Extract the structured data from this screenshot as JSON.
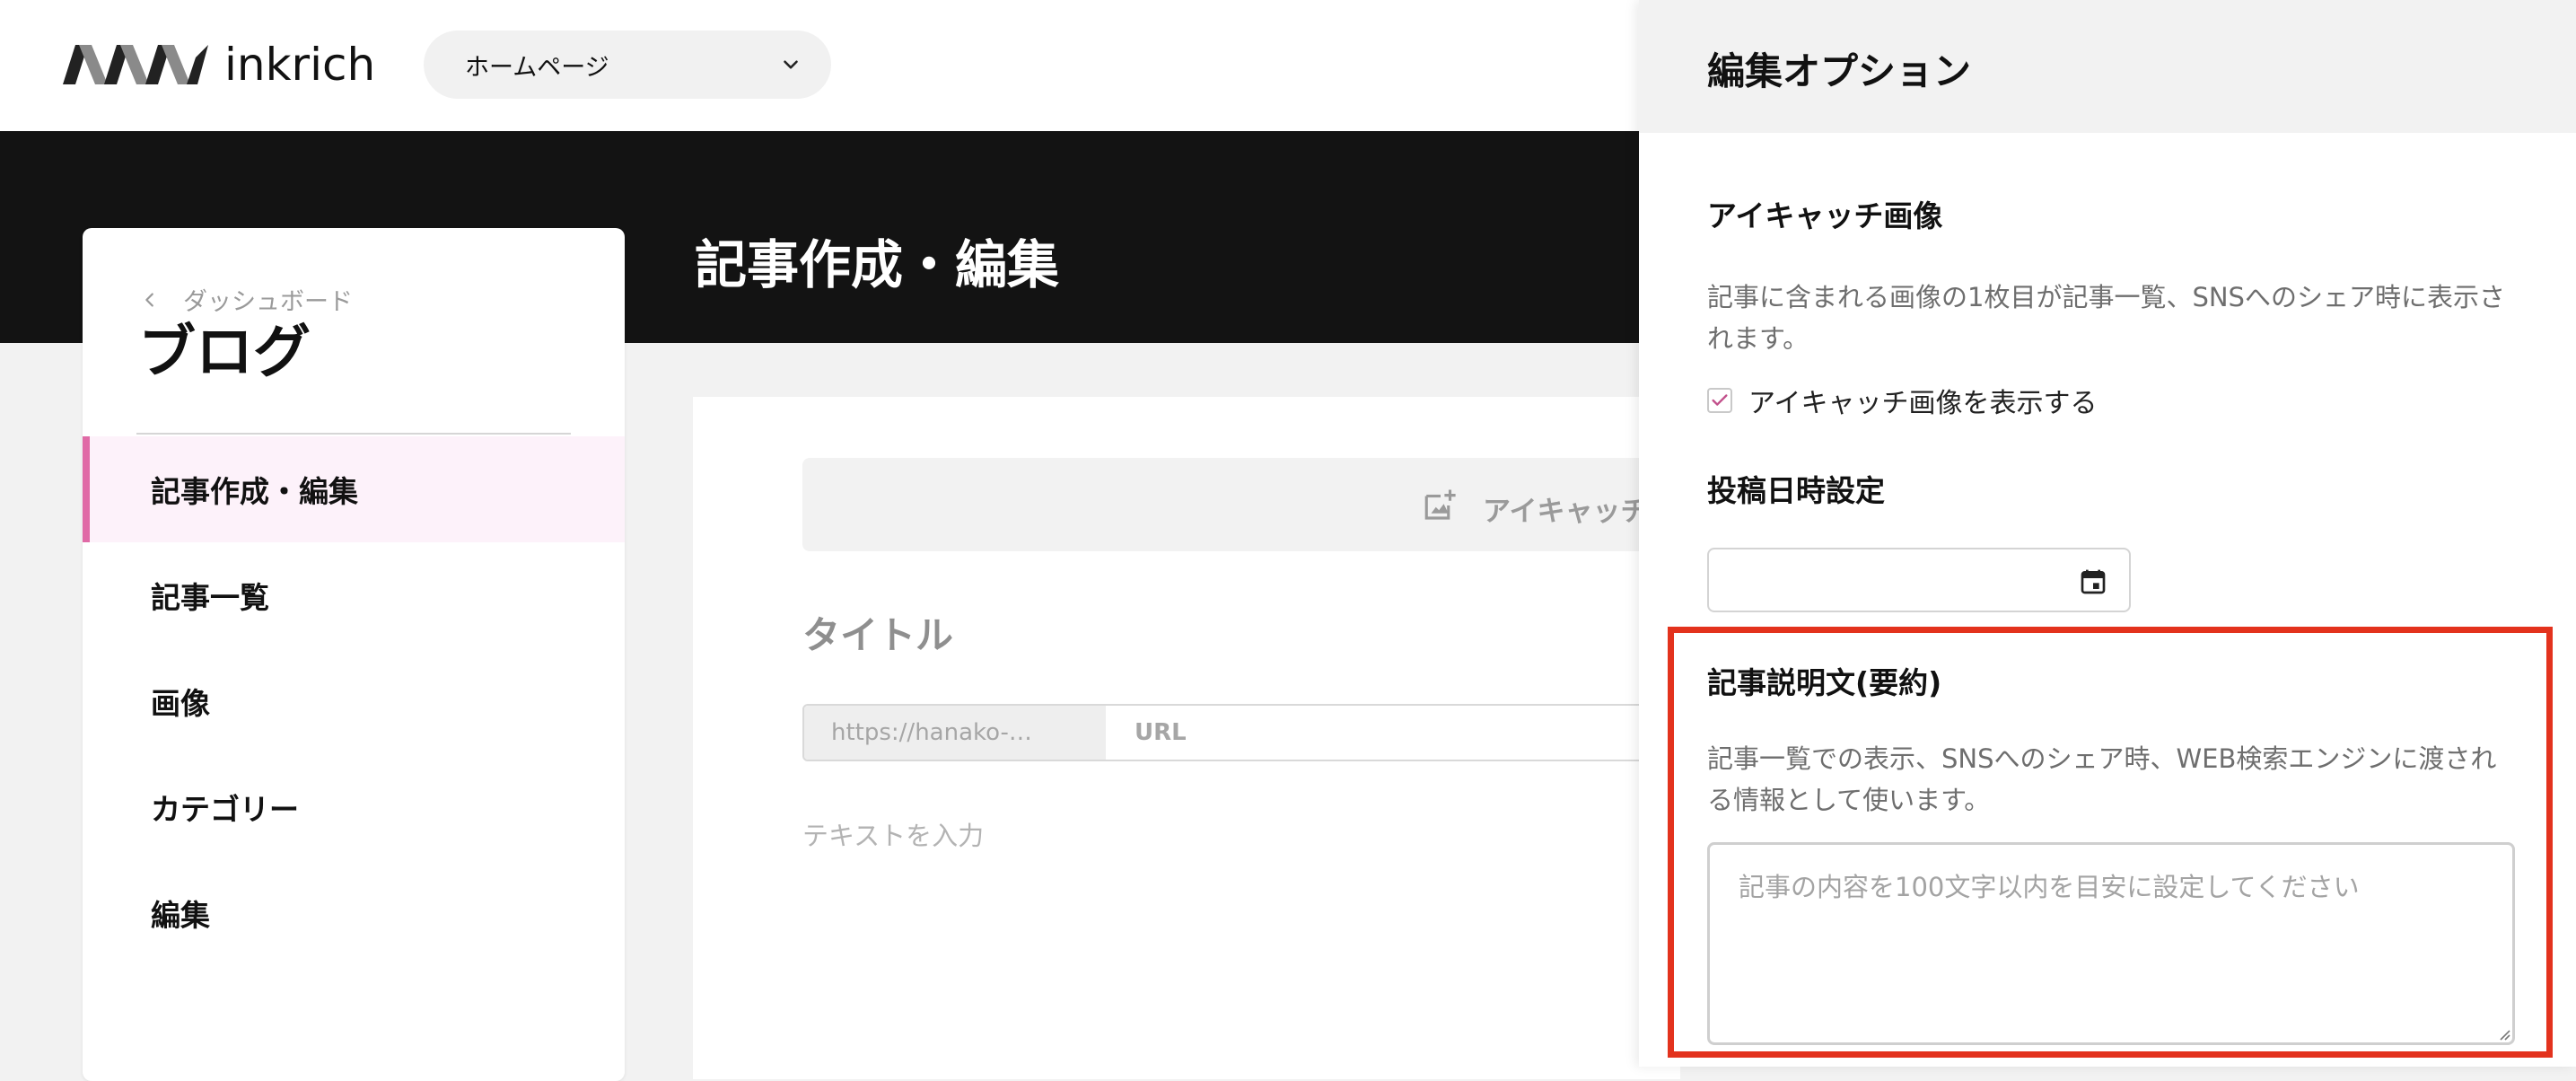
{
  "brand": {
    "name": "inkrich"
  },
  "page_select": {
    "value": "ホームページ"
  },
  "hero": {
    "title": "記事作成・編集"
  },
  "sidebar": {
    "breadcrumb": "ダッシュボード",
    "title": "ブログ",
    "items": [
      {
        "label": "記事作成・編集",
        "active": true
      },
      {
        "label": "記事一覧"
      },
      {
        "label": "画像"
      },
      {
        "label": "カテゴリー"
      },
      {
        "label": "編集"
      }
    ]
  },
  "editor": {
    "eyecatch_label": "アイキャッチ",
    "title_placeholder": "タイトル",
    "url_prefix": "https://hanako-…",
    "url_placeholder": "URL",
    "body_placeholder": "テキストを入力"
  },
  "options_panel": {
    "title": "編集オプション",
    "eyecatch": {
      "heading": "アイキャッチ画像",
      "description": "記事に含まれる画像の1枚目が記事一覧、SNSへのシェア時に表示されます。",
      "checkbox_label": "アイキャッチ画像を表示する",
      "checked": true
    },
    "post_date": {
      "heading": "投稿日時設定",
      "value": ""
    },
    "summary": {
      "heading": "記事説明文(要約)",
      "description": "記事一覧での表示、SNSへのシェア時、WEB検索エンジンに渡される情報として使います。",
      "placeholder": "記事の内容を100文字以内を目安に設定してください",
      "value": ""
    }
  },
  "icons": {
    "page_select": "chevron-down-icon",
    "breadcrumb": "chevron-left-icon",
    "eyecatch": "add-photo-icon",
    "checkbox": "check-icon",
    "date": "calendar-icon"
  },
  "colors": {
    "accent_pink": "#e06aa6",
    "active_bg": "#fdf2fa",
    "hero_bg": "#131313",
    "highlight": "#e3321d"
  }
}
